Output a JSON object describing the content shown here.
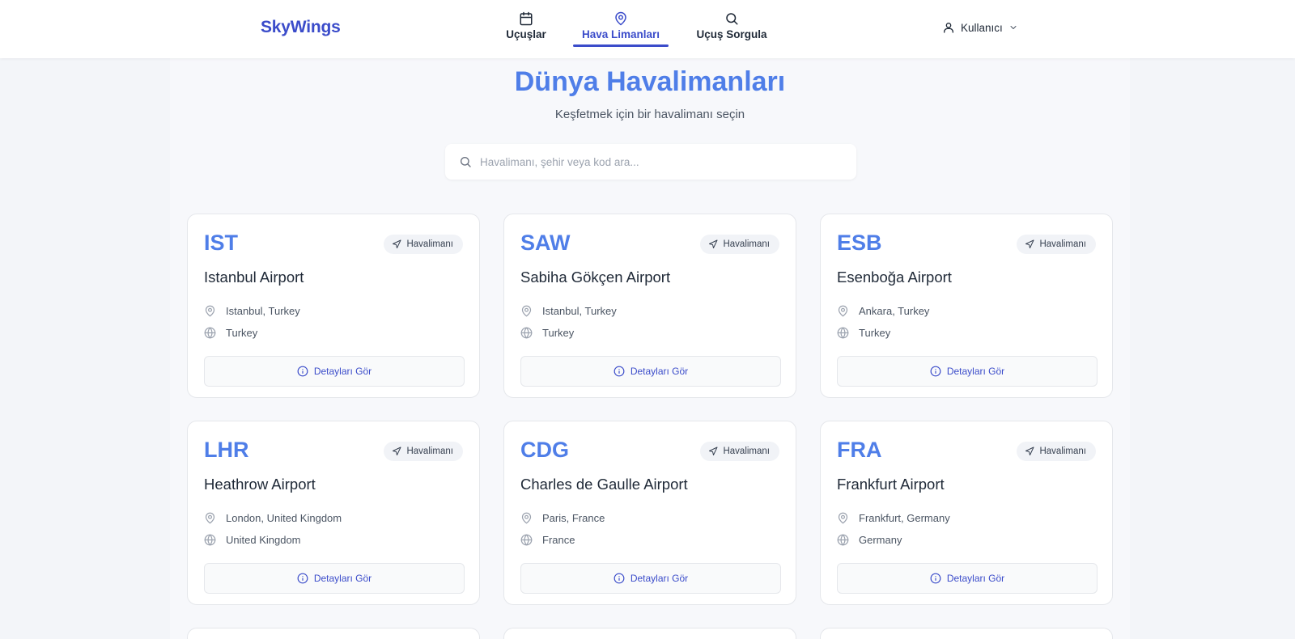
{
  "app": {
    "brand": "SkyWings"
  },
  "nav": {
    "items": [
      {
        "label": "Uçuşlar",
        "icon": "calendar-icon"
      },
      {
        "label": "Hava Limanları",
        "icon": "map-pin-icon",
        "active": true
      },
      {
        "label": "Uçuş Sorgula",
        "icon": "search-icon"
      }
    ]
  },
  "user": {
    "label": "Kullanıcı"
  },
  "page": {
    "title": "Dünya Havalimanları",
    "subtitle": "Keşfetmek için bir havalimanı seçin"
  },
  "search": {
    "placeholder": "Havalimanı, şehir veya kod ara..."
  },
  "colors": {
    "accent": "#4f7ee8",
    "brand": "#3b4cca",
    "background": "#f3f5f9"
  },
  "airports": [
    {
      "code": "IST",
      "tag": "Havalimanı",
      "name": "Istanbul Airport",
      "city": "Istanbul, Turkey",
      "country": "Turkey",
      "action": "Detayları Gör"
    },
    {
      "code": "SAW",
      "tag": "Havalimanı",
      "name": "Sabiha Gökçen Airport",
      "city": "Istanbul, Turkey",
      "country": "Turkey",
      "action": "Detayları Gör"
    },
    {
      "code": "ESB",
      "tag": "Havalimanı",
      "name": "Esenboğa Airport",
      "city": "Ankara, Turkey",
      "country": "Turkey",
      "action": "Detayları Gör"
    },
    {
      "code": "LHR",
      "tag": "Havalimanı",
      "name": "Heathrow Airport",
      "city": "London, United Kingdom",
      "country": "United Kingdom",
      "action": "Detayları Gör"
    },
    {
      "code": "CDG",
      "tag": "Havalimanı",
      "name": "Charles de Gaulle Airport",
      "city": "Paris, France",
      "country": "France",
      "action": "Detayları Gör"
    },
    {
      "code": "FRA",
      "tag": "Havalimanı",
      "name": "Frankfurt Airport",
      "city": "Frankfurt, Germany",
      "country": "Germany",
      "action": "Detayları Gör"
    }
  ]
}
